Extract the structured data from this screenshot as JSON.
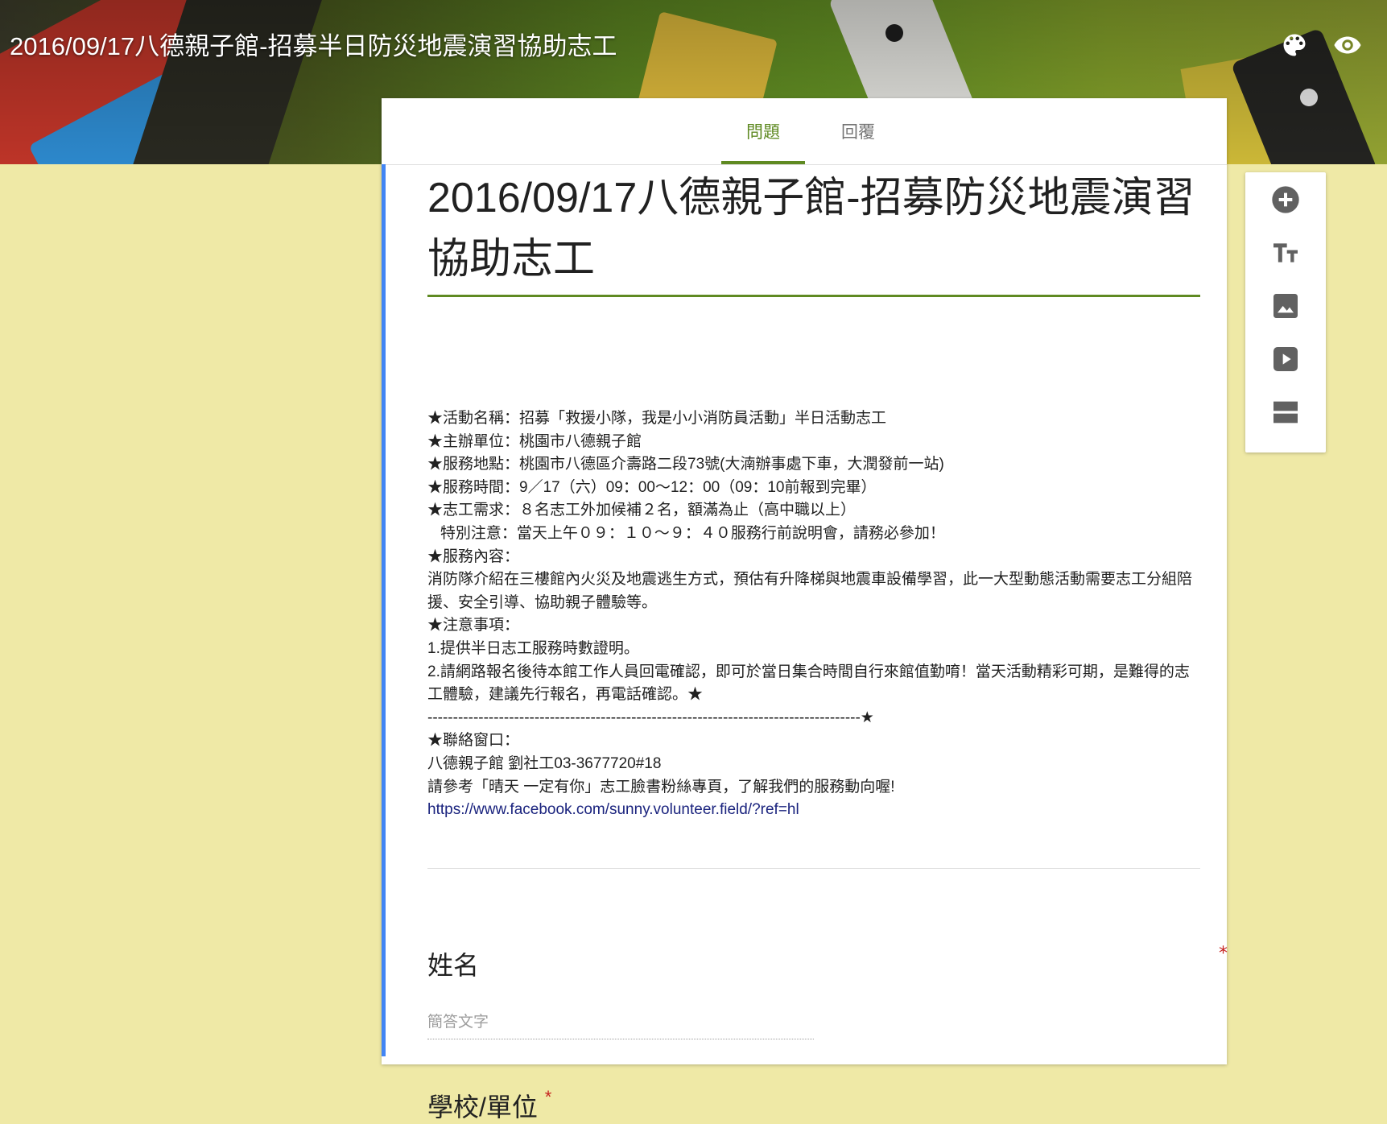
{
  "header": {
    "title": "2016/09/17八德親子館-招募半日防災地震演習協助志工",
    "icons": [
      "palette-icon",
      "preview-icon"
    ]
  },
  "tabs": [
    {
      "label": "問題",
      "active": true
    },
    {
      "label": "回覆",
      "active": false
    }
  ],
  "form": {
    "title": "2016/09/17八德親子館-招募防災地震演習協助志工",
    "description": [
      "★活動名稱：招募「救援小隊，我是小小消防員活動」半日活動志工",
      "★主辦單位：桃園市八德親子館",
      "★服務地點：桃園市八德區介壽路二段73號(大湳辦事處下車，大潤發前一站)",
      "★服務時間：9／17（六）09：00～12：00（09：10前報到完畢）",
      "★志工需求：８名志工外加候補２名，額滿為止（高中職以上）",
      "   特別注意：當天上午０９：１０～９：４０服務行前說明會，請務必參加！",
      "★服務內容：",
      "消防隊介紹在三樓館內火災及地震逃生方式，預估有升降梯與地震車設備學習，此一大型動態活動需要志工分組陪援、安全引導、協助親子體驗等。",
      "★注意事項：",
      "1.提供半日志工服務時數證明。",
      "2.請網路報名後待本館工作人員回電確認，即可於當日集合時間自行來館值勤唷！當天活動精彩可期，是難得的志工體驗，建議先行報名，再電話確認。★",
      "-------------------------------------------------------------------------------------★",
      "★聯絡窗口：",
      "八德親子館 劉社工03-3677720#18"
    ],
    "fb_text": "請參考「晴天 一定有你」志工臉書粉絲專頁，了解我們的服務動向喔! ",
    "fb_link": "https://www.facebook.com/sunny.volunteer.field/?ref=hl"
  },
  "questions": [
    {
      "title": "姓名",
      "required": true,
      "placeholder": "簡答文字"
    },
    {
      "title": "學校/單位",
      "required": true
    }
  ],
  "required_mark": "*",
  "toolbar": [
    "add-question-icon",
    "add-title-icon",
    "add-image-icon",
    "add-video-icon",
    "add-section-icon"
  ],
  "colors": {
    "theme": "#5f8a22",
    "background": "#efe9a6",
    "accent_bar": "#4285f4",
    "required": "#c5221f"
  }
}
